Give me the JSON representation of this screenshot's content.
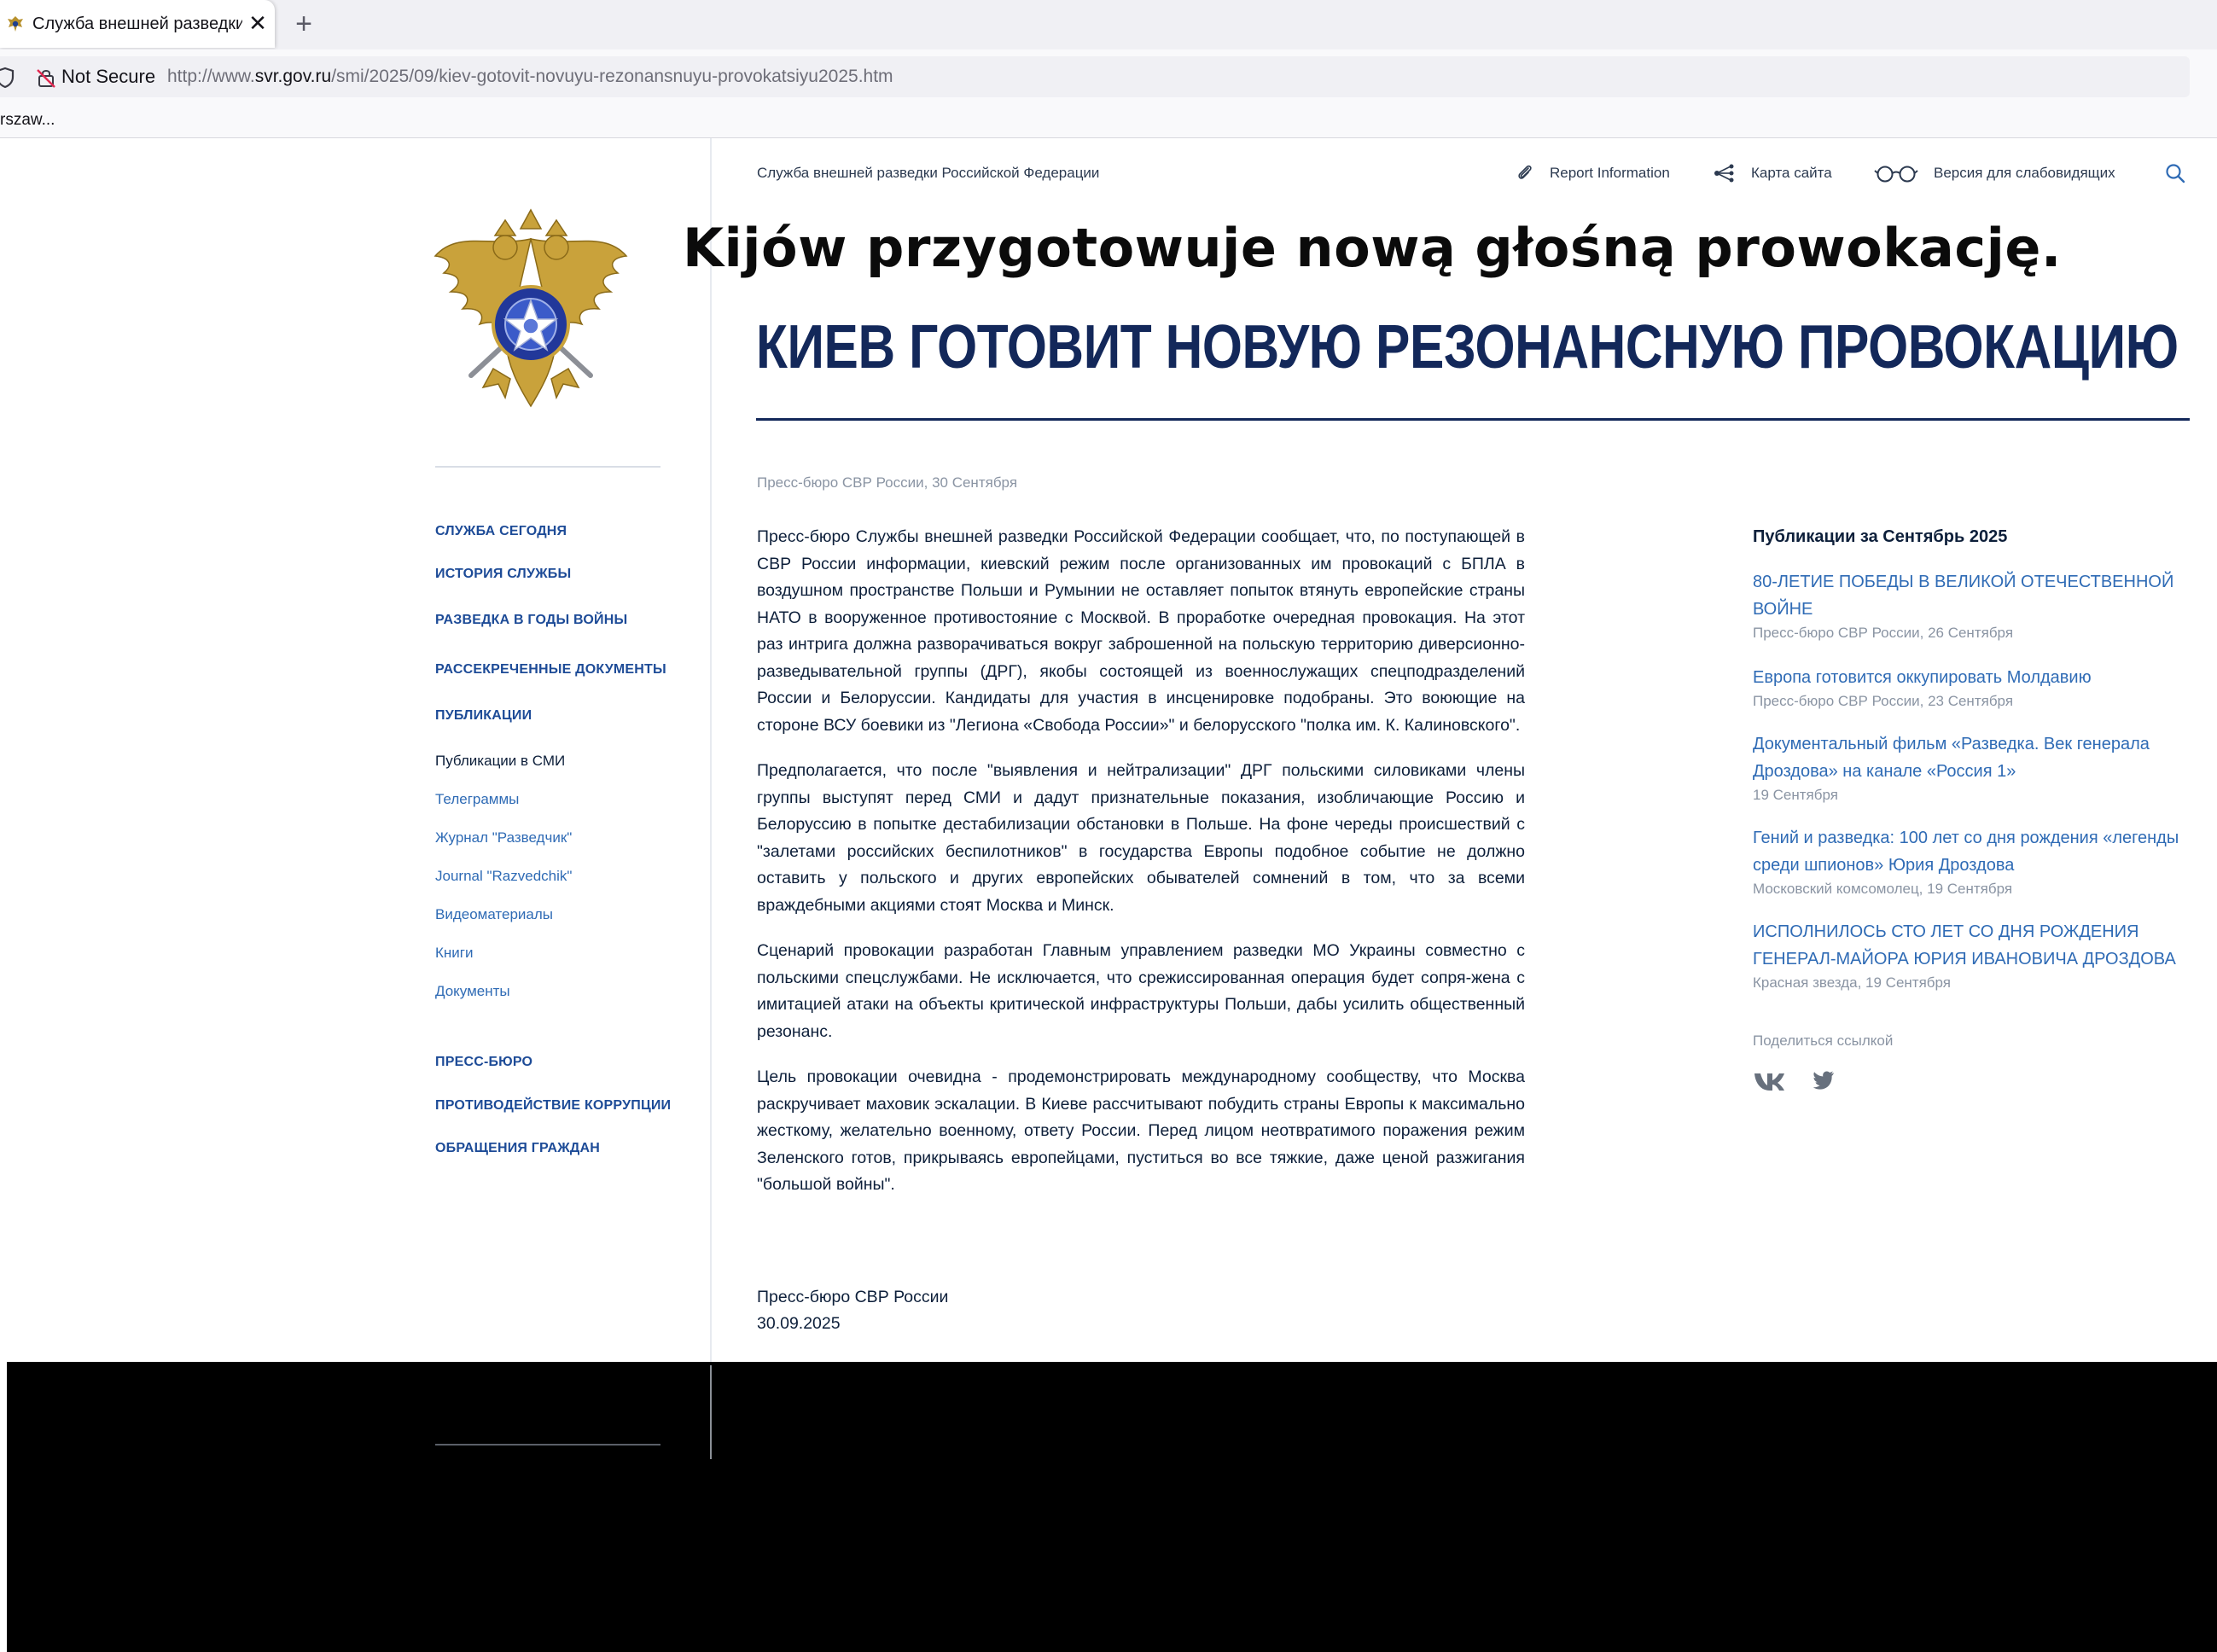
{
  "browser": {
    "tab_title": "Служба внешней разведки Ро",
    "tab_close": "✕",
    "new_tab": "+",
    "not_secure": "Not Secure",
    "url_prefix": "http://www.",
    "url_host": "svr.gov.ru",
    "url_path": "/smi/2025/09/kiev-gotovit-novuyu-rezonansnuyu-provokatsiyu2025.htm",
    "bookmark": "rszaw..."
  },
  "header": {
    "site_name": "Служба внешней разведки Российской Федерации",
    "report": "Report Information",
    "sitemap": "Карта сайта",
    "accessibility": "Версия для слабовидящих"
  },
  "overlay_title": "Kijów przygotowuje nową głośną prowokację.",
  "article": {
    "title": "КИЕВ ГОТОВИТ НОВУЮ РЕЗОНАНСНУЮ ПРОВОКАЦИЮ",
    "meta": "Пресс-бюро СВР России, 30 Сентября",
    "paragraphs": [
      "Пресс-бюро Службы внешней разведки Российской Федерации сообщает, что, по поступающей в СВР России информации, киевский режим после организованных им провокаций с БПЛА в воздушном пространстве Польши и Румынии не оставляет попыток втянуть европейские страны НАТО в вооруженное противостояние с Москвой. В проработке очередная провокация. На этот раз интрига должна разворачиваться вокруг заброшенной на польскую территорию диверсионно-разведывательной группы (ДРГ), якобы состоящей из военнослужащих спецподразделений России и Белоруссии. Кандидаты для участия в инсценировке подобраны. Это воюющие на стороне ВСУ боевики из \"Легиона «Свобода России»\" и белорусского \"полка им. К. Калиновского\".",
      "Предполагается, что после \"выявления и нейтрализации\" ДРГ польскими силовиками члены группы выступят перед СМИ и дадут признательные показания, изобличающие Россию и Белоруссию в попытке дестабилизации обстановки в Польше. На фоне череды происшествий с \"залетами российских беспилотников\" в государства Европы подобное событие не должно оставить у польского и других европейских обывателей сомнений в том, что за всеми враждебными акциями стоят Москва и Минск.",
      "Сценарий провокации разработан Главным управлением разведки МО Украины совместно с польскими спецслужбами. Не исключается, что срежиссированная операция будет сопря-жена с имитацией атаки на объекты критической инфраструктуры Польши, дабы усилить общественный резонанс.",
      "Цель провокации очевидна - продемонстрировать международному сообществу, что Москва раскручивает маховик эскалации. В Киеве рассчитывают побудить страны Европы к максимально жесткому, желательно военному, ответу России. Перед лицом неотвратимого поражения режим Зеленского готов, прикрываясь европейцами, пуститься во все тяжкие, даже ценой разжигания \"большой войны\"."
    ],
    "signature_org": "Пресс-бюро СВР России",
    "signature_date": "30.09.2025"
  },
  "sidenav": {
    "sections": [
      "СЛУЖБА СЕГОДНЯ",
      "ИСТОРИЯ СЛУЖБЫ",
      "РАЗВЕДКА В ГОДЫ ВОЙНЫ",
      "РАССЕКРЕЧЕННЫЕ ДОКУМЕНТЫ",
      "ПУБЛИКАЦИИ"
    ],
    "publications": [
      "Публикации в СМИ",
      "Телеграммы",
      "Журнал \"Разведчик\"",
      "Journal \"Razvedchik\"",
      "Видеоматериалы",
      "Книги",
      "Документы"
    ],
    "lower_sections": [
      "ПРЕСС-БЮРО",
      "ПРОТИВОДЕЙСТВИЕ КОРРУПЦИИ",
      "ОБРАЩЕНИЯ ГРАЖДАН"
    ]
  },
  "sidebar": {
    "heading": "Публикации за Сентябрь 2025",
    "items": [
      {
        "title": "80-ЛЕТИЕ ПОБЕДЫ В ВЕЛИКОЙ ОТЕЧЕСТВЕННОЙ ВОЙНЕ",
        "meta": "Пресс-бюро СВР России, 26 Сентября"
      },
      {
        "title": "Европа готовится оккупировать Молдавию",
        "meta": "Пресс-бюро СВР России, 23 Сентября"
      },
      {
        "title": "Документальный фильм «Разведка. Век генерала Дроздова» на канале «Россия 1»",
        "meta": "19 Сентября"
      },
      {
        "title": "Гений и разведка: 100 лет со дня рождения «легенды среди шпионов» Юрия Дроздова",
        "meta": "Московский комсомолец, 19 Сентября"
      },
      {
        "title": "ИСПОЛНИЛОСЬ СТО ЛЕТ СО ДНЯ РОЖДЕНИЯ ГЕНЕРАЛ-МАЙОРА ЮРИЯ ИВАНОВИЧА ДРОЗДОВА",
        "meta": "Красная звезда, 19 Сентября"
      }
    ],
    "share_label": "Поделиться ссылкой"
  },
  "colors": {
    "title_navy": "#13285a",
    "link_blue": "#2f6bb5",
    "nav_blue": "#1d4b97",
    "text": "#0d1f3a",
    "muted": "#8a94a3"
  }
}
